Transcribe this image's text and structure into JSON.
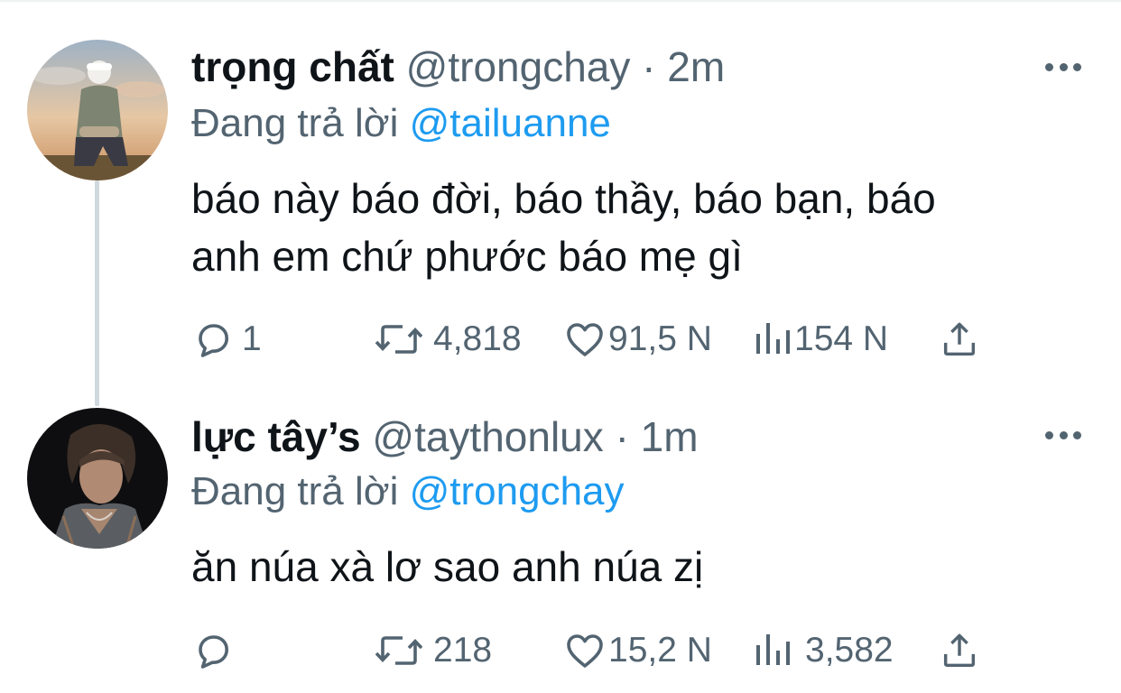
{
  "tweets": [
    {
      "name": "trọng chất",
      "handle": "@trongchay",
      "separator": "·",
      "time": "2m",
      "reply_prefix": "Đang trả lời",
      "reply_to": "@tailuanne",
      "text_lines": [
        "báo này báo đời, báo thầy, báo bạn, báo",
        "anh em chứ phước báo mẹ gì"
      ],
      "stats": {
        "replies": "1",
        "retweets": "4,818",
        "likes": "91,5 N",
        "views": "154 N"
      }
    },
    {
      "name": "lực tây’s",
      "handle": "@taythonlux",
      "separator": "·",
      "time": "1m",
      "reply_prefix": "Đang trả lời",
      "reply_to": "@trongchay",
      "text_lines": [
        "ăn núa xà lơ sao anh núa zị"
      ],
      "stats": {
        "replies": "",
        "retweets": "218",
        "likes": "15,2 N",
        "views": "3,582"
      }
    }
  ],
  "colors": {
    "text": "#0f1419",
    "muted": "#536471",
    "link": "#1d9bf0",
    "thread_line": "#cfd9de"
  },
  "icons": [
    "reply-icon",
    "retweet-icon",
    "like-icon",
    "views-icon",
    "share-icon",
    "more-icon"
  ]
}
